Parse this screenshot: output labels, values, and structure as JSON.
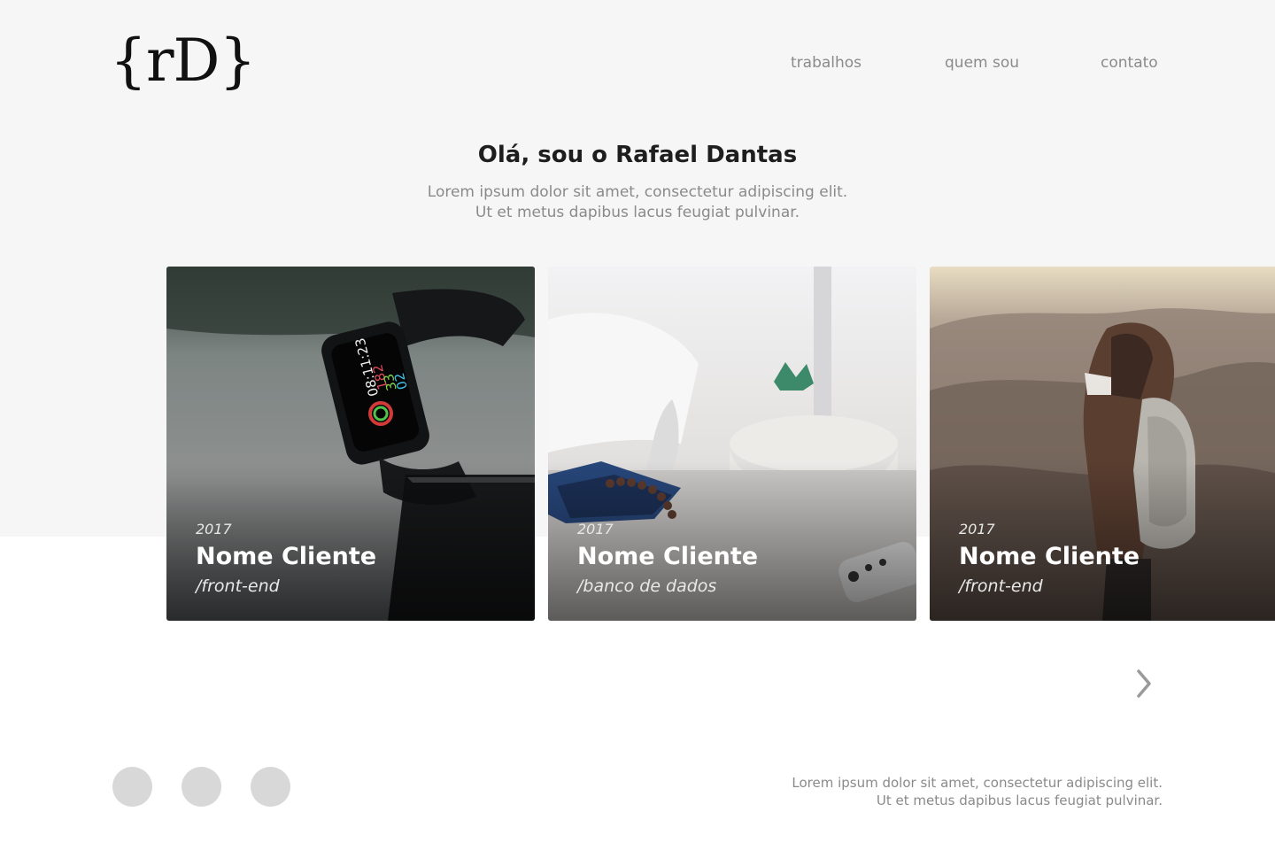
{
  "brand": {
    "logo_text": "{rD}"
  },
  "nav": {
    "items": [
      {
        "label": "trabalhos"
      },
      {
        "label": "quem sou"
      },
      {
        "label": "contato"
      }
    ]
  },
  "hero": {
    "title": "Olá, sou o Rafael Dantas",
    "subtitle_line1": "Lorem ipsum dolor sit amet, consectetur adipiscing elit.",
    "subtitle_line2": "Ut et metus dapibus lacus feugiat pulvinar."
  },
  "projects": [
    {
      "year": "2017",
      "client": "Nome Cliente",
      "tag": "/front-end",
      "image": "smartwatch-photo"
    },
    {
      "year": "2017",
      "client": "Nome Cliente",
      "tag": "/banco de dados",
      "image": "desk-photo"
    },
    {
      "year": "2017",
      "client": "Nome Cliente",
      "tag": "/front-end",
      "image": "hiker-photo"
    }
  ],
  "carousel": {
    "next_icon": "chevron-right-icon"
  },
  "social": {
    "count": 3,
    "color": "#d8d8d8"
  },
  "footer": {
    "line1": "Lorem ipsum dolor sit amet, consectetur adipiscing elit.",
    "line2": "Ut et metus dapibus lacus feugiat pulvinar."
  },
  "colors": {
    "hero_bg": "#f6f6f6",
    "text_muted": "#8a8a8a",
    "text_dark": "#1e1e1e"
  }
}
